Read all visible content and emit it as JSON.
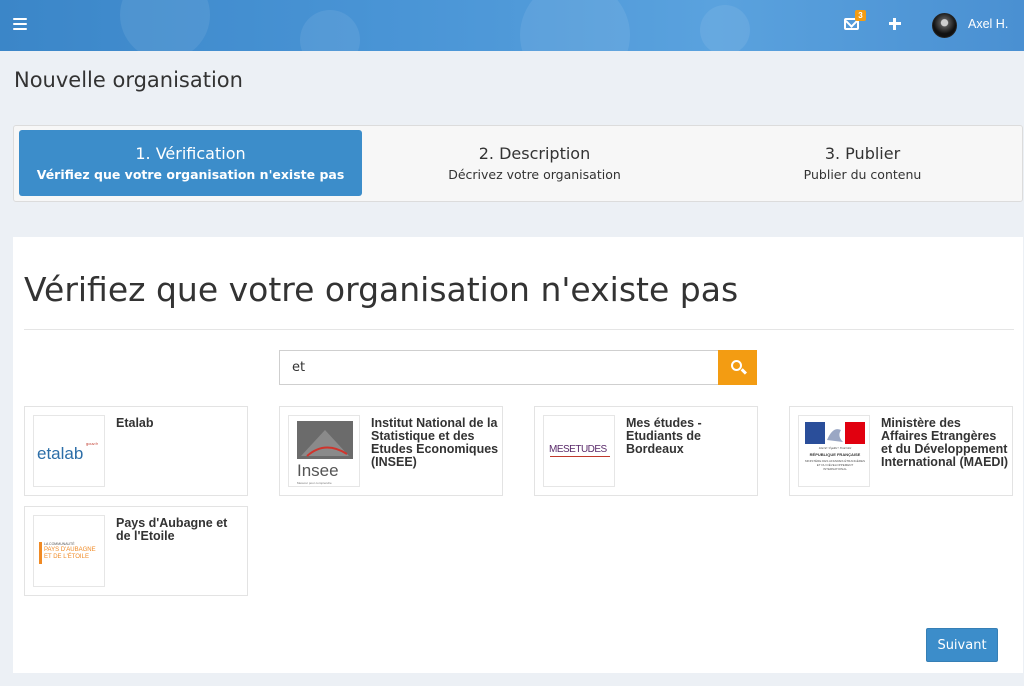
{
  "header": {
    "notification_count": "3",
    "user_name": "Axel H."
  },
  "page": {
    "title": "Nouvelle organisation"
  },
  "steps": [
    {
      "label": "1. Vérification",
      "sub": "Vérifiez que votre organisation n'existe pas",
      "active": true
    },
    {
      "label": "2. Description",
      "sub": "Décrivez votre organisation",
      "active": false
    },
    {
      "label": "3. Publier",
      "sub": "Publier du contenu",
      "active": false
    }
  ],
  "main": {
    "heading": "Vérifiez que votre organisation n'existe pas",
    "search": {
      "value": "et",
      "icon": "search-icon"
    },
    "results": [
      {
        "name": "Etalab",
        "logo_text": "etalab",
        "logo_sup": "gouv.fr"
      },
      {
        "name": "Institut National de la Statistique et des Etudes Economiques (INSEE)",
        "logo_text": "Insee",
        "logo_sub": "Mesurer pour comprendre"
      },
      {
        "name": "Mes études - Etudiants de Bordeaux",
        "logo_text": "MESETUDES"
      },
      {
        "name": "Ministère des Affaires Etrangères et du Développement International (MAEDI)",
        "logo_text": "RÉPUBLIQUE FRANÇAISE",
        "logo_motto": "Liberté • Égalité • Fraternité",
        "logo_sub": "MINISTÈRE DES AFFAIRES ÉTRANGÈRES ET DU DÉVELOPPEMENT INTERNATIONAL"
      },
      {
        "name": "Pays d'Aubagne et de l'Etoile",
        "logo_top": "LA COMMUNAUTÉ",
        "logo_text": "PAYS D'AUBAGNE ET DE L'ÉTOILE"
      }
    ],
    "next_label": "Suivant"
  },
  "colors": {
    "primary": "#3c8dca",
    "accent": "#f39c12",
    "background": "#ecf0f5"
  }
}
